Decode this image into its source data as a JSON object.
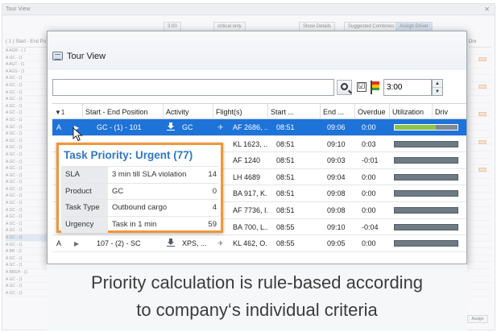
{
  "background": {
    "title": "Tour View",
    "toolbar": {
      "time": "3:00",
      "critical_only": "critical only",
      "show_details": "Show Details",
      "suggested_combines": "Suggested Combines",
      "assign_driver": "Assign Driver"
    },
    "grid_header": "( 1 ) Start - End Po",
    "rows": [
      "A  AGR - ( 1",
      "A  GC - (1",
      "A  AGT - (1",
      "A  AGS - (1",
      "A  GC - (1",
      "A  GC - (1",
      "A  GC - (1",
      "A  GC - (1",
      "A  GC - (1",
      "A  GC - (1",
      "A  GC - (1",
      "A  GC - (1",
      "A  GC - (1",
      "A  GC - (1",
      "A  GC - (1",
      "A  GC - (1",
      "A  GC - (1",
      "A  GC - (1",
      "A  GC - (1",
      "A  GC - (1",
      "A  GC - (1",
      "A  GC - (1",
      "A  GC - (1",
      "A  GC - (1",
      "A  GC - (1",
      "A  GC - (1",
      "A  GC - (1",
      "A  GC - (1",
      "A  GC - (1",
      "A  BR - (1",
      "A  GC - (1",
      "A  GC - (1",
      "A  BREH - (1",
      "A  GC - (1",
      "A  GC - (1",
      "A  GC - (1"
    ],
    "right_header": "Drv",
    "assign": "Assign"
  },
  "window": {
    "title": "Tour View",
    "search_value": "",
    "checkbox_mark": "☑",
    "time_value": "3:00",
    "spin_up": "▲",
    "spin_down": "▼"
  },
  "table": {
    "sort_indicator": "▼1",
    "columns": [
      "Start - End Position",
      "Activity",
      "Flight(s)",
      "Start ...",
      "End ...",
      "Overdue",
      "Utilization",
      "Driv"
    ],
    "rows": [
      {
        "prio": "A",
        "position": "GC - (1) - 101",
        "activity": "GC",
        "flights": "AF 2686, ...",
        "start": "08:51",
        "end": "09:06",
        "overdue": "0:00",
        "util": 0.65,
        "selected": true
      },
      {
        "prio": "",
        "position": "",
        "activity": "",
        "flights": "KL 1623, ...",
        "start": "08:51",
        "end": "09:10",
        "overdue": "0:03",
        "util": 0,
        "selected": false
      },
      {
        "prio": "",
        "position": "",
        "activity": "",
        "flights": "AF 1240",
        "start": "08:51",
        "end": "09:03",
        "overdue": "-0:01",
        "util": 0,
        "selected": false
      },
      {
        "prio": "",
        "position": "",
        "activity": "",
        "flights": "LH 4689",
        "start": "08:51",
        "end": "09:04",
        "overdue": "0:00",
        "util": 0,
        "selected": false
      },
      {
        "prio": "",
        "position": "",
        "activity": "",
        "flights": "BA 917, K...",
        "start": "08:51",
        "end": "09:08",
        "overdue": "0:00",
        "util": 0,
        "selected": false
      },
      {
        "prio": "",
        "position": "",
        "activity": "",
        "flights": "AF 7736, I...",
        "start": "08:51",
        "end": "09:08",
        "overdue": "0:00",
        "util": 0,
        "selected": false
      },
      {
        "prio": "",
        "position": "",
        "activity": "",
        "flights": "BA 700, L...",
        "start": "08:55",
        "end": "09:10",
        "overdue": "-0:04",
        "util": 0,
        "selected": false
      },
      {
        "prio": "A",
        "position": "107 - (2) - SC",
        "activity": "XPS, ...",
        "flights": "KL 462, O...",
        "start": "08:55",
        "end": "09:05",
        "overdue": "0:00",
        "util": 0,
        "selected": false
      }
    ]
  },
  "tooltip": {
    "title": "Task Priority: Urgent (77)",
    "rows": [
      {
        "key": "SLA",
        "value": "3 min till SLA violation",
        "score": "14"
      },
      {
        "key": "Product",
        "value": "GC",
        "score": "0"
      },
      {
        "key": "Task Type",
        "value": "Outbound cargo",
        "score": "4"
      },
      {
        "key": "Urgency",
        "value": "Task in 1 min",
        "score": "59"
      }
    ]
  },
  "caption": {
    "line1": "Priority calculation is rule-based according",
    "line2": "to company‘s individual criteria"
  },
  "colors": {
    "selection": "#1e73d8",
    "tooltip_border": "#f0963a",
    "tooltip_title": "#2d78c6",
    "utilization_fill": "#8ec34a"
  }
}
